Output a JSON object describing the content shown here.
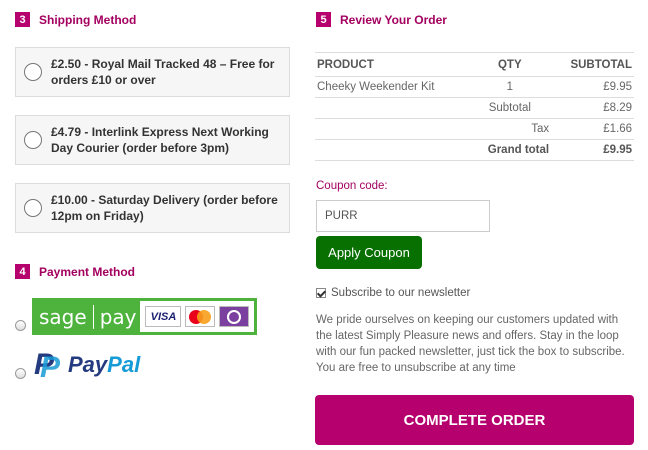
{
  "shipping": {
    "num": "3",
    "title": "Shipping Method",
    "options": [
      {
        "line1": "£2.50 - Royal Mail Tracked 48 – Free for",
        "line2": "orders £10 or over"
      },
      {
        "line1": "£4.79 - Interlink Express Next Working",
        "line2": "Day Courier (order before 3pm)"
      },
      {
        "line1": "£10.00 - Saturday Delivery (order before",
        "line2": "12pm on Friday)"
      }
    ]
  },
  "payment": {
    "num": "4",
    "title": "Payment Method",
    "sagepay": {
      "sage": "sage",
      "pay": "pay",
      "visa": "VISA"
    },
    "paypal": {
      "pay": "Pay",
      "pal": "Pal",
      "mark": "P"
    }
  },
  "review": {
    "num": "5",
    "title": "Review Your Order",
    "headers": {
      "product": "PRODUCT",
      "qty": "QTY",
      "subtotal": "SUBTOTAL"
    },
    "item": {
      "product": "Cheeky Weekender Kit",
      "qty": "1",
      "subtotal": "£9.95"
    },
    "subtotal": {
      "label": "Subtotal",
      "value": "£8.29"
    },
    "tax": {
      "label": "Tax",
      "value": "£1.66"
    },
    "grand_total": {
      "label": "Grand total",
      "value": "£9.95"
    }
  },
  "coupon": {
    "label": "Coupon code:",
    "value": "PURR",
    "button": "Apply Coupon"
  },
  "newsletter": {
    "label": "Subscribe to our newsletter",
    "checked": true,
    "description": "We pride ourselves on keeping our customers updated with the latest Simply Pleasure news and offers. Stay in the loop with our fun packed newsletter, just tick the box to subscribe. You are free to unsubscribe at any time"
  },
  "complete_button": "COMPLETE ORDER",
  "colors": {
    "accent": "#b5006e",
    "coupon_button": "#087000",
    "sagepay_green": "#4db33d",
    "paypal_dark": "#253b80",
    "paypal_light": "#179bd7"
  }
}
